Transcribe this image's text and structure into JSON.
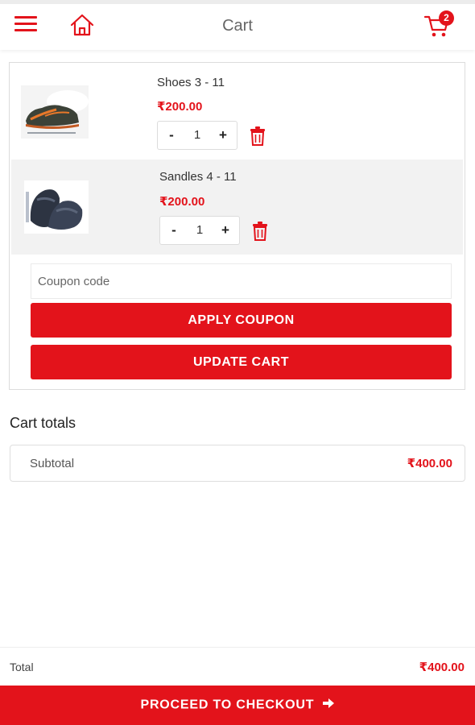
{
  "header": {
    "title": "Cart",
    "cart_count": "2",
    "icons": [
      "menu-icon",
      "home-icon",
      "cart-icon"
    ]
  },
  "cart": {
    "items": [
      {
        "name": "Shoes 3 - 11",
        "price": "₹200.00",
        "quantity": "1",
        "minus": "-",
        "plus": "+"
      },
      {
        "name": "Sandles 4 - 11",
        "price": "₹200.00",
        "quantity": "1",
        "minus": "-",
        "plus": "+"
      }
    ]
  },
  "coupon": {
    "placeholder": "Coupon code",
    "value": "",
    "apply_label": "APPLY COUPON",
    "update_label": "UPDATE CART"
  },
  "totals": {
    "heading": "Cart totals",
    "subtotal_label": "Subtotal",
    "subtotal_value": "₹400.00",
    "total_label": "Total",
    "total_value": "₹400.00"
  },
  "checkout": {
    "label": "PROCEED TO CHECKOUT"
  },
  "colors": {
    "accent": "#e3131b",
    "text": "#333333",
    "border": "#dcdcdc"
  }
}
